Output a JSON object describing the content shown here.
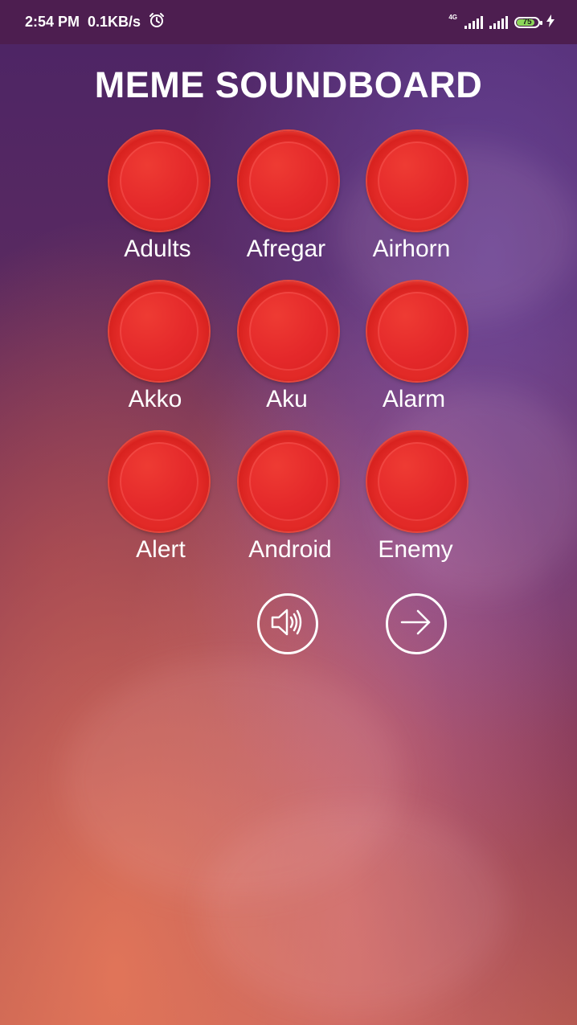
{
  "status_bar": {
    "time": "2:54 PM",
    "speed": "0.1KB/s",
    "network": "4G",
    "battery": "75"
  },
  "title": "MEME SOUNDBOARD",
  "sounds": [
    {
      "label": "Adults"
    },
    {
      "label": "Afregar"
    },
    {
      "label": "Airhorn"
    },
    {
      "label": "Akko"
    },
    {
      "label": "Aku"
    },
    {
      "label": "Alarm"
    },
    {
      "label": "Alert"
    },
    {
      "label": "Android"
    },
    {
      "label": "Enemy"
    }
  ],
  "colors": {
    "status_bar": "#4d1e50",
    "button_red": "#e22a27",
    "text": "#ffffff"
  },
  "icons": {
    "volume": "speaker-volume-icon",
    "next": "arrow-right-icon"
  }
}
